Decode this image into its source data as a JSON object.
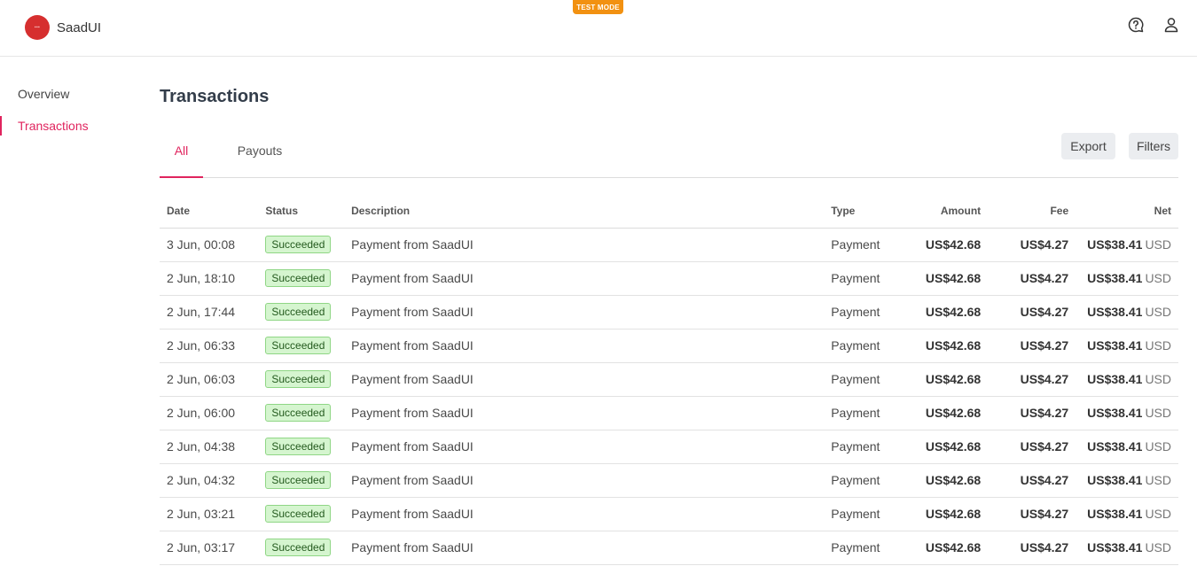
{
  "header": {
    "brand_name": "SaadUI",
    "test_mode_label": "TEST MODE",
    "help_icon": "help-icon",
    "user_icon": "user-icon"
  },
  "sidebar": {
    "items": [
      {
        "label": "Overview",
        "active": false
      },
      {
        "label": "Transactions",
        "active": true
      }
    ]
  },
  "main": {
    "title": "Transactions",
    "tabs": [
      {
        "label": "All",
        "active": true
      },
      {
        "label": "Payouts",
        "active": false
      }
    ],
    "export_label": "Export",
    "filters_label": "Filters"
  },
  "table": {
    "columns": {
      "date": "Date",
      "status": "Status",
      "description": "Description",
      "type": "Type",
      "amount": "Amount",
      "fee": "Fee",
      "net": "Net"
    },
    "rows": [
      {
        "date": "3 Jun, 00:08",
        "status": "Succeeded",
        "description": "Payment from SaadUI",
        "type": "Payment",
        "amount": "US$42.68",
        "fee": "US$4.27",
        "net": "US$38.41",
        "net_currency": "USD"
      },
      {
        "date": "2 Jun, 18:10",
        "status": "Succeeded",
        "description": "Payment from SaadUI",
        "type": "Payment",
        "amount": "US$42.68",
        "fee": "US$4.27",
        "net": "US$38.41",
        "net_currency": "USD"
      },
      {
        "date": "2 Jun, 17:44",
        "status": "Succeeded",
        "description": "Payment from SaadUI",
        "type": "Payment",
        "amount": "US$42.68",
        "fee": "US$4.27",
        "net": "US$38.41",
        "net_currency": "USD"
      },
      {
        "date": "2 Jun, 06:33",
        "status": "Succeeded",
        "description": "Payment from SaadUI",
        "type": "Payment",
        "amount": "US$42.68",
        "fee": "US$4.27",
        "net": "US$38.41",
        "net_currency": "USD"
      },
      {
        "date": "2 Jun, 06:03",
        "status": "Succeeded",
        "description": "Payment from SaadUI",
        "type": "Payment",
        "amount": "US$42.68",
        "fee": "US$4.27",
        "net": "US$38.41",
        "net_currency": "USD"
      },
      {
        "date": "2 Jun, 06:00",
        "status": "Succeeded",
        "description": "Payment from SaadUI",
        "type": "Payment",
        "amount": "US$42.68",
        "fee": "US$4.27",
        "net": "US$38.41",
        "net_currency": "USD"
      },
      {
        "date": "2 Jun, 04:38",
        "status": "Succeeded",
        "description": "Payment from SaadUI",
        "type": "Payment",
        "amount": "US$42.68",
        "fee": "US$4.27",
        "net": "US$38.41",
        "net_currency": "USD"
      },
      {
        "date": "2 Jun, 04:32",
        "status": "Succeeded",
        "description": "Payment from SaadUI",
        "type": "Payment",
        "amount": "US$42.68",
        "fee": "US$4.27",
        "net": "US$38.41",
        "net_currency": "USD"
      },
      {
        "date": "2 Jun, 03:21",
        "status": "Succeeded",
        "description": "Payment from SaadUI",
        "type": "Payment",
        "amount": "US$42.68",
        "fee": "US$4.27",
        "net": "US$38.41",
        "net_currency": "USD"
      },
      {
        "date": "2 Jun, 03:17",
        "status": "Succeeded",
        "description": "Payment from SaadUI",
        "type": "Payment",
        "amount": "US$42.68",
        "fee": "US$4.27",
        "net": "US$38.41",
        "net_currency": "USD"
      }
    ]
  },
  "colors": {
    "accent": "#e0245e",
    "test_mode": "#f29111",
    "brand_logo": "#d62f2f",
    "success_bg": "#d5f5cf",
    "success_border": "#8fd685"
  }
}
